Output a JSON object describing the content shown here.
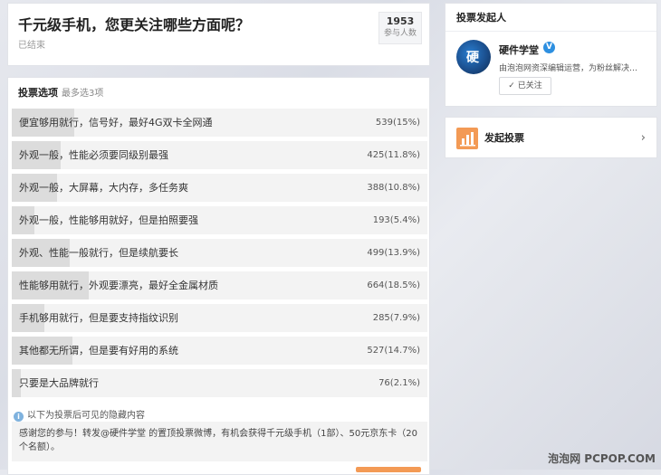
{
  "poll": {
    "title": "千元级手机，您更关注哪些方面呢？",
    "status": "已结束",
    "participants": "1953",
    "participants_label": "参与人数"
  },
  "options_header": {
    "title": "投票选项",
    "hint": "最多选3项"
  },
  "options": [
    {
      "label": "便宜够用就行，信号好，最好4G双卡全网通",
      "value": "539(15%)",
      "percent": 15
    },
    {
      "label": "外观一般，性能必须要同级别最强",
      "value": "425(11.8%)",
      "percent": 11.8
    },
    {
      "label": "外观一般，大屏幕，大内存，多任务爽",
      "value": "388(10.8%)",
      "percent": 10.8
    },
    {
      "label": "外观一般，性能够用就好，但是拍照要强",
      "value": "193(5.4%)",
      "percent": 5.4
    },
    {
      "label": "外观、性能一般就行，但是续航要长",
      "value": "499(13.9%)",
      "percent": 13.9
    },
    {
      "label": "性能够用就行，外观要漂亮，最好全金属材质",
      "value": "664(18.5%)",
      "percent": 18.5
    },
    {
      "label": "手机够用就行，但是要支持指纹识别",
      "value": "285(7.9%)",
      "percent": 7.9
    },
    {
      "label": "其他都无所谓，但是要有好用的系统",
      "value": "527(14.7%)",
      "percent": 14.7
    },
    {
      "label": "只要是大品牌就行",
      "value": "76(2.1%)",
      "percent": 2.1
    }
  ],
  "hidden_note": "以下为投票后可见的隐藏内容",
  "thanks_text": "感谢您的参与！转发@硬件学堂 的置顶投票微博，有机会获得千元级手机（1部）、50元京东卡（20个名额）。",
  "initiator": {
    "header": "投票发起人",
    "name": "硬件学堂",
    "description": "由泡泡网资深编辑运营，为粉丝解决…",
    "follow_label": "✓ 已关注",
    "avatar_glyph": "硬"
  },
  "start_poll": {
    "label": "发起投票",
    "chevron": "›"
  },
  "watermark": "泡泡网 PCPOP.COM",
  "icons": {
    "info": "i",
    "verified": "V"
  },
  "colors": {
    "accent": "#f39a55",
    "verified": "#2d8fe0",
    "bar_fill": "#dcdcdc"
  }
}
